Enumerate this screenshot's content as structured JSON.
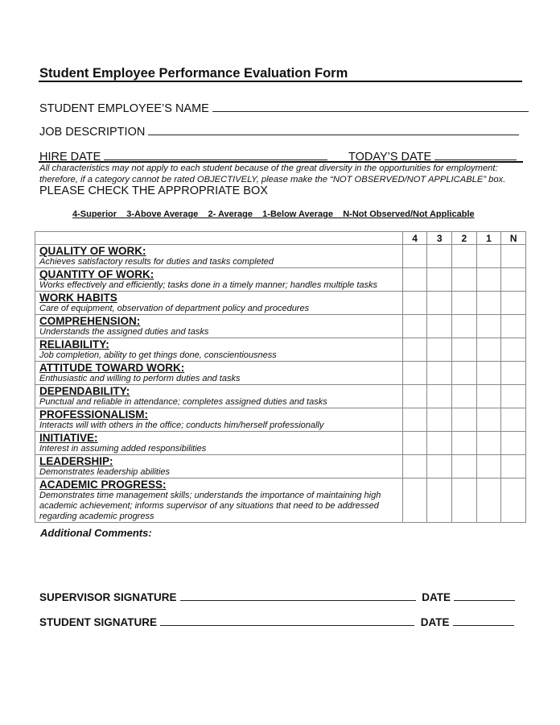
{
  "header": {
    "title": "Student Employee Performance Evaluation Form"
  },
  "fields": {
    "student_name_label": "STUDENT EMPLOYEE’S NAME",
    "student_name_value": "",
    "job_description_label": "JOB DESCRIPTION",
    "job_description_value": "",
    "hire_date_label": "HIRE DATE",
    "hire_date_value": "",
    "todays_date_label": "TODAY’S DATE",
    "todays_date_value": ""
  },
  "instructions": {
    "note": "All characteristics may not apply to each student because of the great diversity in the opportunities for employment: therefore, if a category cannot be rated OBJECTIVELY, please make the “NOT OBSERVED/NOT APPLICABLE” box.",
    "check_label": "PLEASE CHECK THE APPROPRIATE BOX",
    "legend": "4-Superior    3-Above Average    2- Average    1-Below Average    N-Not Observed/Not Applicable"
  },
  "table": {
    "rating_columns": [
      "4",
      "3",
      "2",
      "1",
      "N"
    ],
    "criteria": [
      {
        "title": "QUALITY OF WORK:",
        "description": "Achieves satisfactory results for duties and tasks completed"
      },
      {
        "title": "QUANTITY OF WORK:",
        "description": "Works effectively and efficiently; tasks done in a timely manner; handles multiple tasks"
      },
      {
        "title": "WORK HABITS",
        "description": "Care of equipment, observation of department policy and procedures"
      },
      {
        "title": "COMPREHENSION:",
        "description": "Understands the assigned duties and tasks"
      },
      {
        "title": "RELIABILITY:",
        "description": "Job completion, ability to get things done, conscientiousness"
      },
      {
        "title": "ATTITUDE TOWARD WORK:",
        "description": "Enthusiastic and willing to perform duties and tasks"
      },
      {
        "title": "DEPENDABILITY:",
        "description": "Punctual and reliable in attendance; completes assigned duties and tasks"
      },
      {
        "title": "PROFESSIONALISM:",
        "description": "Interacts will with others in the office; conducts him/herself professionally"
      },
      {
        "title": "INITIATIVE:",
        "description": "Interest in assuming added responsibilities"
      },
      {
        "title": "LEADERSHIP:",
        "description": "Demonstrates leadership abilities"
      },
      {
        "title": "ACADEMIC PROGRESS:",
        "description": "Demonstrates time management skills; understands the importance of maintaining high academic achievement; informs supervisor of any situations that need to be addressed regarding academic progress"
      }
    ]
  },
  "comments": {
    "label": "Additional Comments:",
    "value": ""
  },
  "signatures": {
    "supervisor_label": "SUPERVISOR SIGNATURE",
    "student_label": "STUDENT SIGNATURE",
    "date_label": "DATE"
  }
}
